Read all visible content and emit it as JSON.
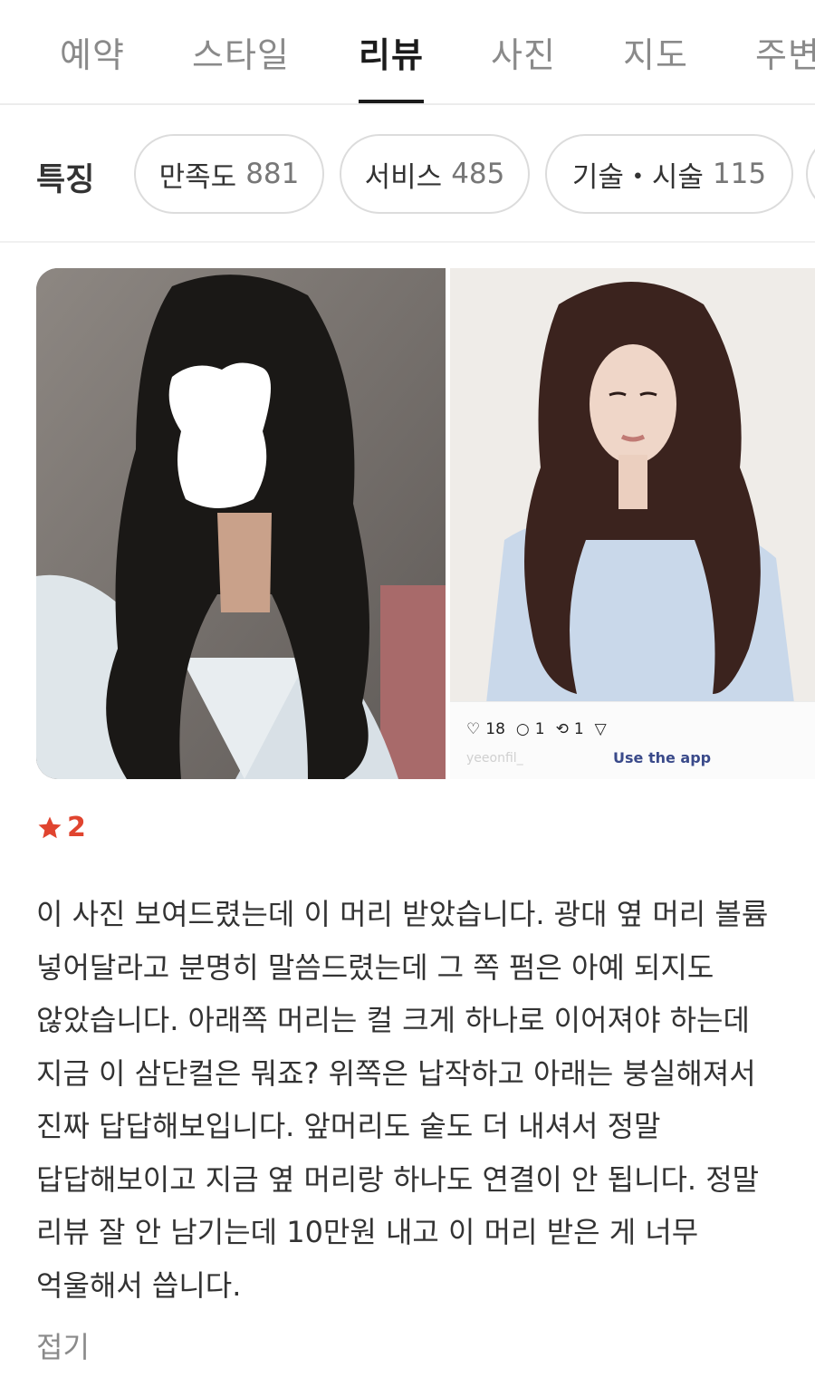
{
  "tabs": [
    {
      "label": "예약",
      "active": false
    },
    {
      "label": "스타일",
      "active": false
    },
    {
      "label": "리뷰",
      "active": true
    },
    {
      "label": "사진",
      "active": false
    },
    {
      "label": "지도",
      "active": false
    },
    {
      "label": "주변",
      "active": false
    }
  ],
  "features": {
    "label": "특징",
    "chips": [
      {
        "name": "만족도",
        "count": "881"
      },
      {
        "name": "서비스",
        "count": "485"
      },
      {
        "name": "기술・시술",
        "count": "115"
      }
    ]
  },
  "review": {
    "rating": "2",
    "star_color": "#e0442f",
    "photo_overlay": {
      "likes": "18",
      "comments": "1",
      "reposts": "1",
      "username": "yeeonfil_",
      "use_app_label": "Use the app"
    },
    "text": "이 사진 보여드렸는데 이 머리 받았습니다. 광대 옆 머리 볼륨 넣어달라고 분명히 말씀드렸는데 그 쪽 펌은 아예 되지도 않았습니다. 아래쪽 머리는 컬 크게 하나로 이어져야 하는데 지금 이 삼단컬은 뭐죠? 위쪽은 납작하고 아래는 붕실해져서 진짜 답답해보입니다. 앞머리도 숱도 더 내셔서 정말 답답해보이고 지금 옆 머리랑 하나도 연결이 안 됩니다. 정말 리뷰 잘 안 남기는데 10만원 내고 이 머리 받은 게 너무 억울해서 씁니다.",
    "collapse_label": "접기"
  }
}
